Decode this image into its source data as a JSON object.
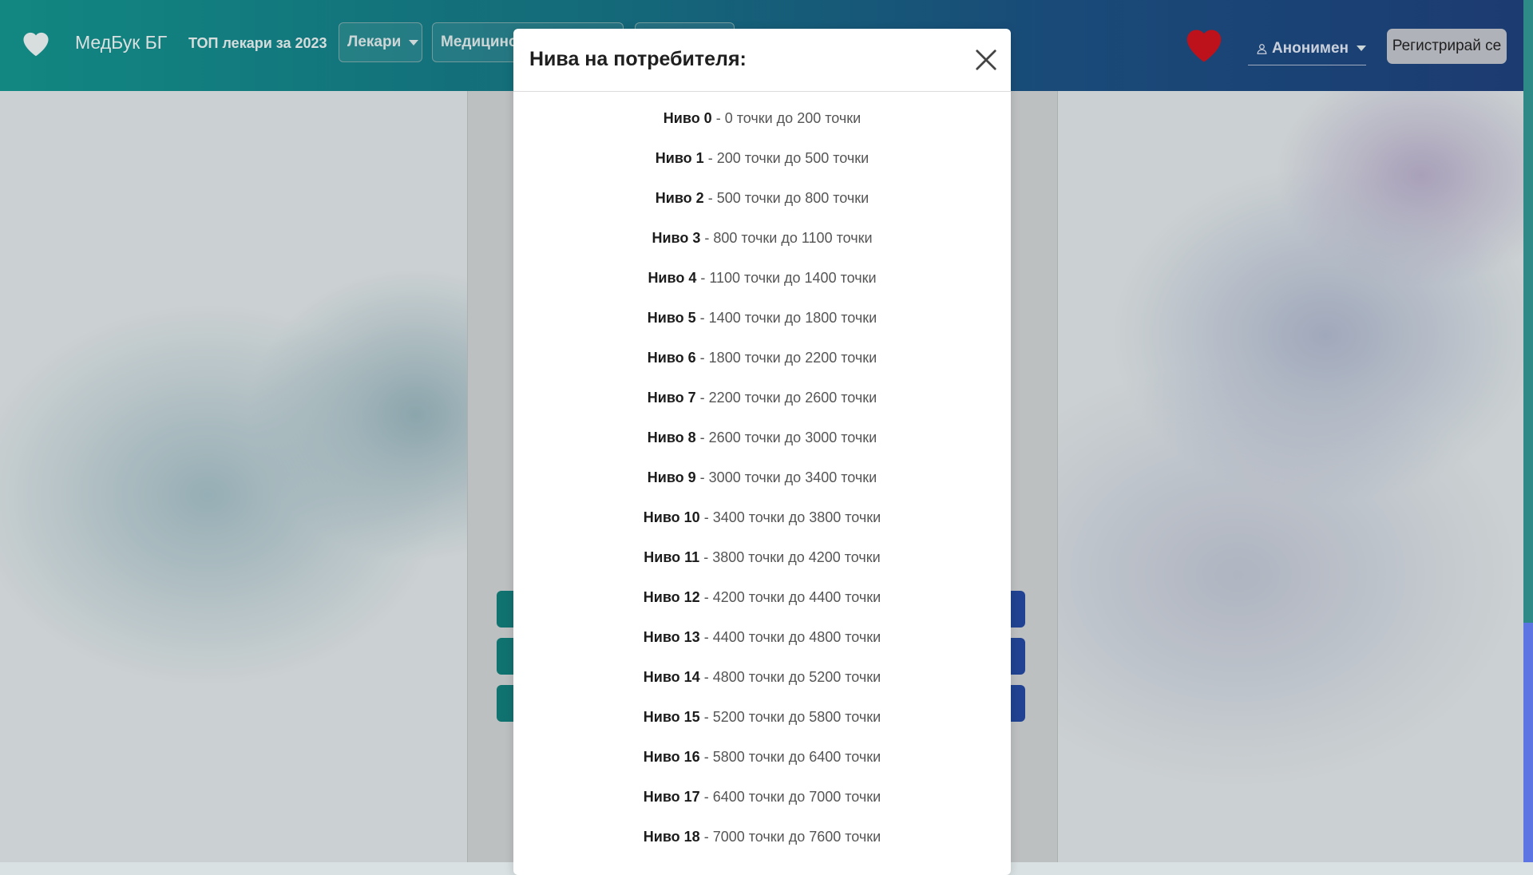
{
  "navbar": {
    "brand": "МедБук БГ",
    "top_link": "ТОП лекари за 2023",
    "dropdowns": [
      "Лекари",
      "Медицински",
      ""
    ],
    "user": "Анонимен",
    "register": "Регистрирай се"
  },
  "modal": {
    "title": "Нива на потребителя:",
    "separator": " - ",
    "levels": [
      {
        "name": "Ниво 0",
        "range": "0 точки до 200 точки"
      },
      {
        "name": "Ниво 1",
        "range": "200 точки до 500 точки"
      },
      {
        "name": "Ниво 2",
        "range": "500 точки до 800 точки"
      },
      {
        "name": "Ниво 3",
        "range": "800 точки до 1100 точки"
      },
      {
        "name": "Ниво 4",
        "range": "1100 точки до 1400 точки"
      },
      {
        "name": "Ниво 5",
        "range": "1400 точки до 1800 точки"
      },
      {
        "name": "Ниво 6",
        "range": "1800 точки до 2200 точки"
      },
      {
        "name": "Ниво 7",
        "range": "2200 точки до 2600 точки"
      },
      {
        "name": "Ниво 8",
        "range": "2600 точки до 3000 точки"
      },
      {
        "name": "Ниво 9",
        "range": "3000 точки до 3400 точки"
      },
      {
        "name": "Ниво 10",
        "range": "3400 точки до 3800 точки"
      },
      {
        "name": "Ниво 11",
        "range": "3800 точки до 4200 точки"
      },
      {
        "name": "Ниво 12",
        "range": "4200 точки до 4400 точки"
      },
      {
        "name": "Ниво 13",
        "range": "4400 точки до 4800 точки"
      },
      {
        "name": "Ниво 14",
        "range": "4800 точки до 5200 точки"
      },
      {
        "name": "Ниво 15",
        "range": "5200 точки до 5800 точки"
      },
      {
        "name": "Ниво 16",
        "range": "5800 точки до 6400 точки"
      },
      {
        "name": "Ниво 17",
        "range": "6400 точки до 7000 точки"
      },
      {
        "name": "Ниво 18",
        "range": "7000 точки до 7600 точки"
      }
    ]
  },
  "icons": {
    "brand": "heart-icon",
    "favorites": "heart-icon",
    "user": "user-icon",
    "close": "close-icon"
  },
  "colors": {
    "nav_start": "#138f88",
    "nav_end": "#1e3f78",
    "heart": "#c8141e",
    "modal_bg": "#ffffff"
  }
}
